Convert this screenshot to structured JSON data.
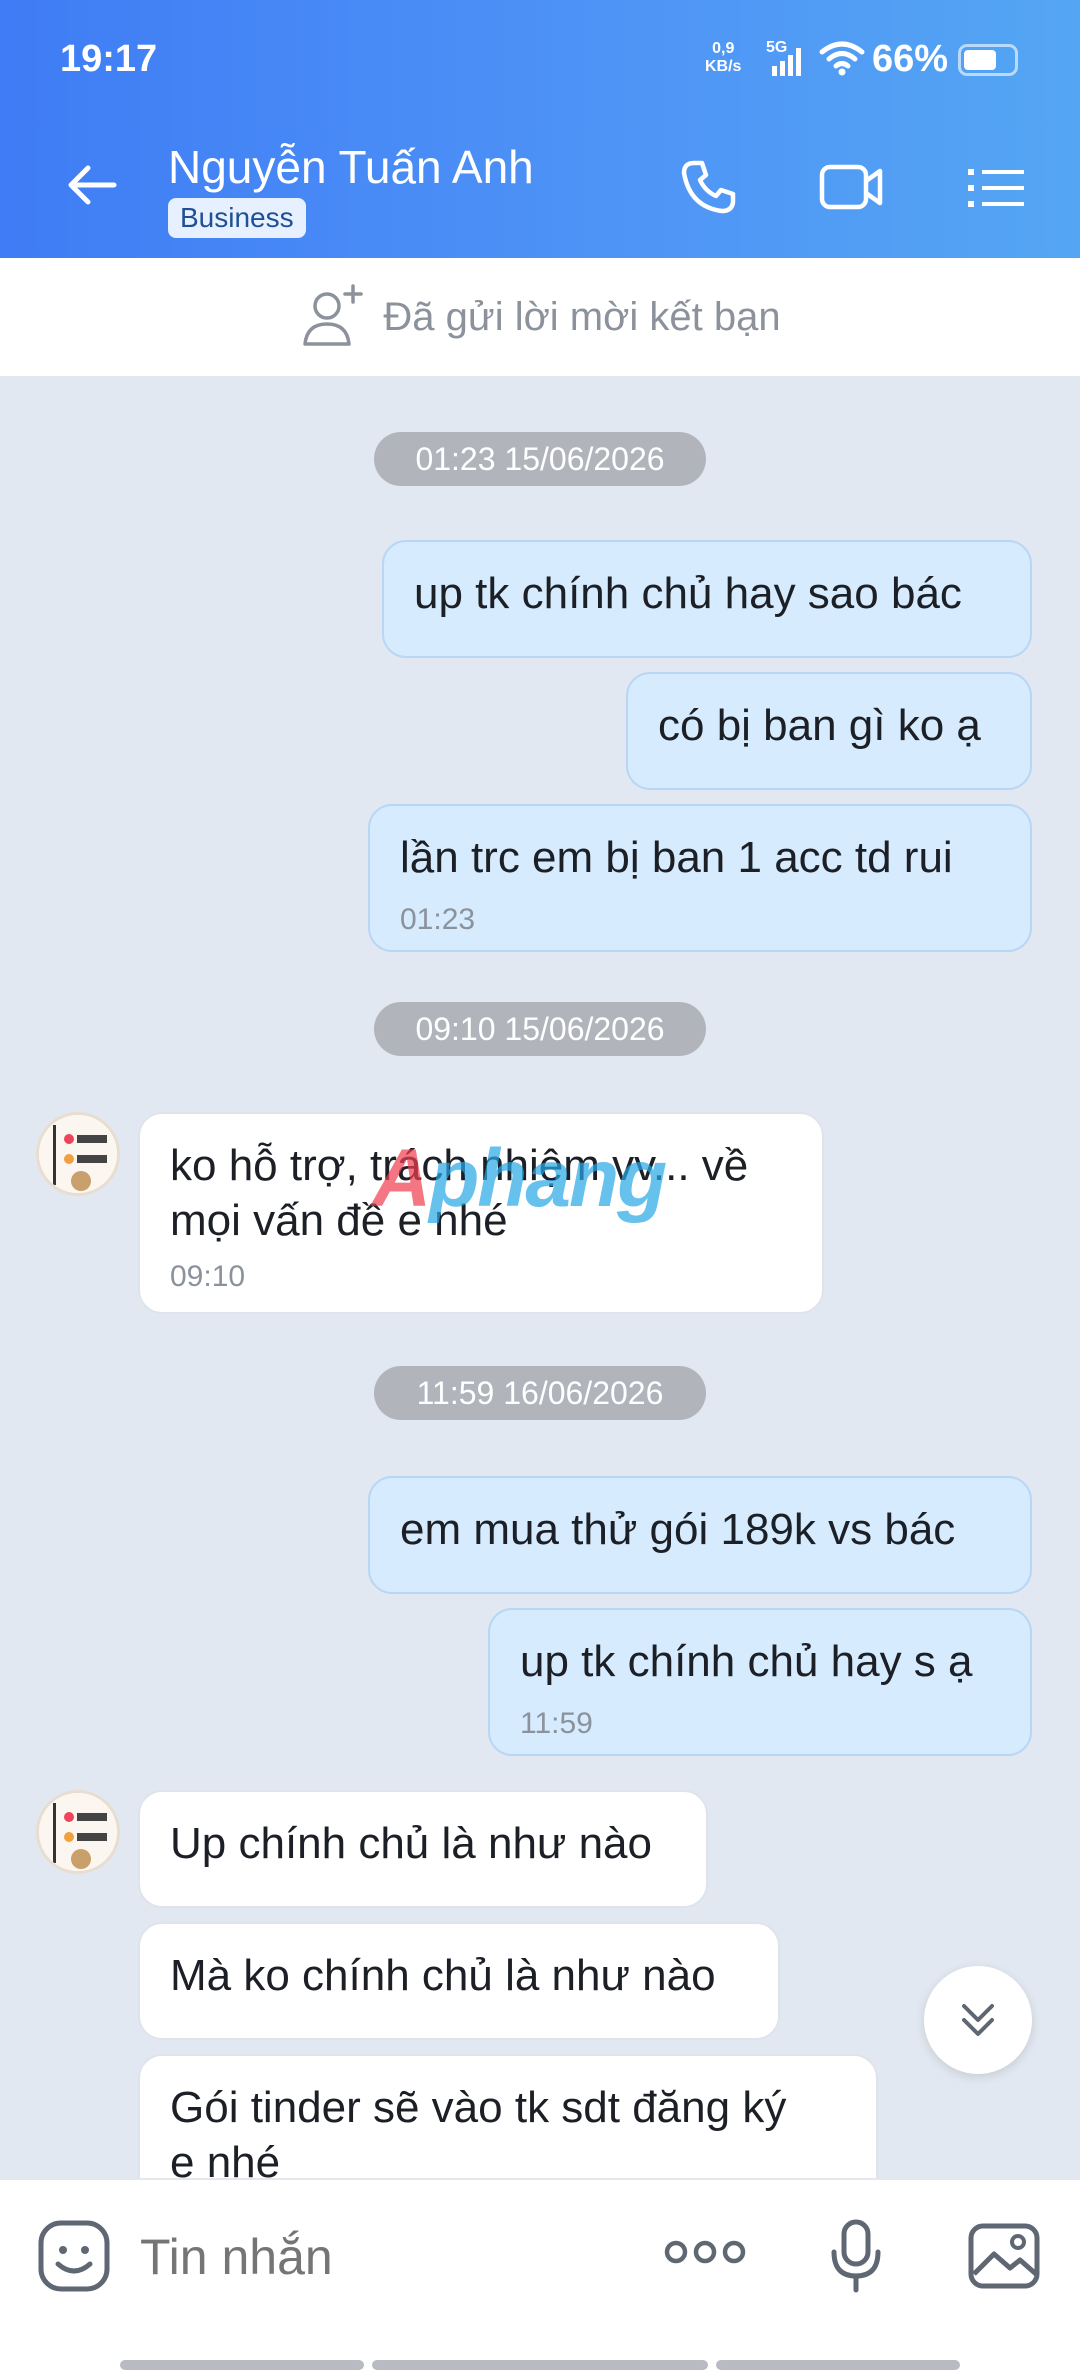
{
  "status_bar": {
    "time": "19:17",
    "net_speed": "0,9",
    "net_unit": "KB/s",
    "network": "5G",
    "battery": "66%",
    "battery_level": 0.66
  },
  "header": {
    "contact_name": "Nguyễn Tuấn Anh",
    "badge": "Business",
    "icons": [
      "back-arrow-icon",
      "phone-icon",
      "video-call-icon",
      "menu-list-icon"
    ]
  },
  "friend_request": {
    "text": "Đã gửi lời mời kết bạn",
    "icon": "add-friend-icon"
  },
  "messages": {
    "ts1": "01:23 15/06/2026",
    "m1": "up tk chính chủ hay sao bác",
    "m2": "có bị ban gì ko ạ",
    "m3": "lần trc em bị ban 1 acc td rui",
    "m3_time": "01:23",
    "ts2": "09:10 15/06/2026",
    "m4_line1": "ko hỗ trợ, trách nhiệm vv... về",
    "m4_line2": "mọi vấn đề  e nhé",
    "m4_time": "09:10",
    "ts3": "11:59 16/06/2026",
    "m5": "em mua thử gói 189k vs bác",
    "m6": "up tk chính chủ hay s ạ",
    "m6_time": "11:59",
    "m7": "Up chính chủ là như nào",
    "m8": "Mà ko chính chủ là như nào",
    "m9_line1": "Gói tinder sẽ vào tk sdt đăng ký",
    "m9_line2": "e nhé"
  },
  "watermark": "Aphang",
  "composer": {
    "placeholder": "Tin nhắn"
  },
  "colors": {
    "header_start": "#3f7cf5",
    "header_end": "#54a6f3",
    "outgoing": "#d6ebfd",
    "incoming": "#ffffff",
    "chat_bg": "#e2e8f1"
  }
}
